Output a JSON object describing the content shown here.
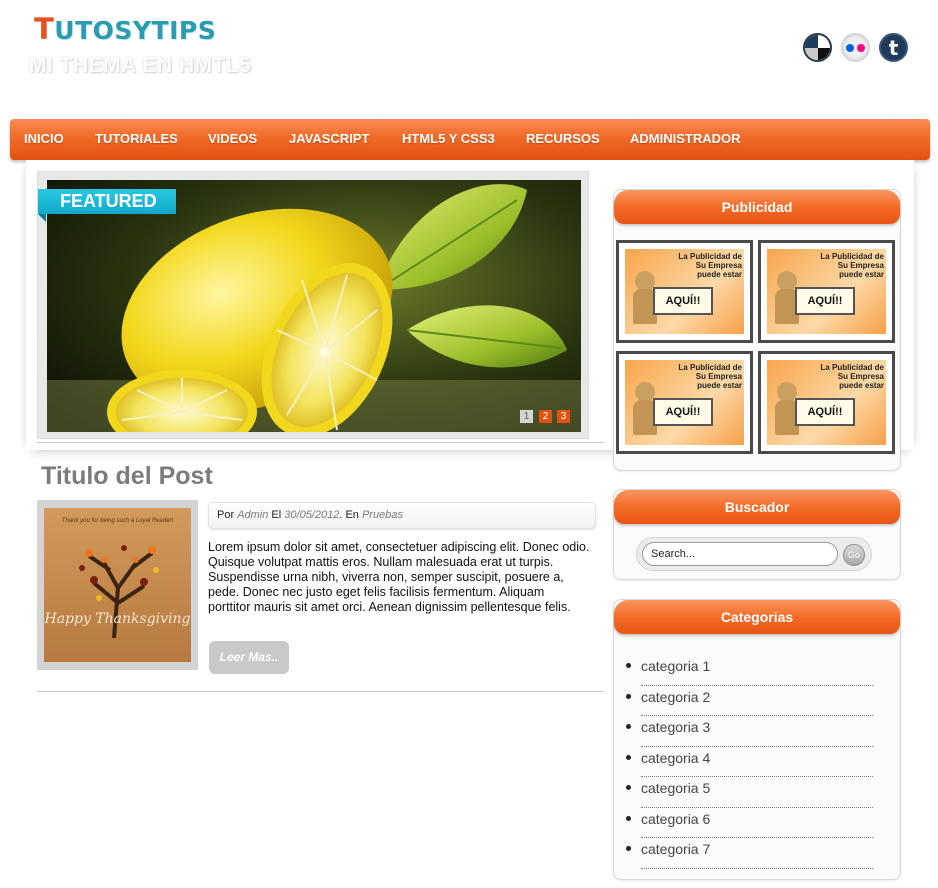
{
  "header": {
    "logo_first": "T",
    "logo_rest": "UTOSYTIPS",
    "tagline": "MI THEMA EN HMTL5"
  },
  "nav": {
    "items": [
      "INICIO",
      "TUTORIALES",
      "VIDEOS",
      "JAVASCRIPT",
      "HTML5 Y CSS3",
      "RECURSOS",
      "ADMINISTRADOR"
    ]
  },
  "slider": {
    "badge": "FEATURED",
    "pages": [
      "1",
      "2",
      "3"
    ]
  },
  "post": {
    "title": "Titulo del Post",
    "meta_by": "Por ",
    "author": "Admin",
    "meta_on": " El ",
    "date": "30/05/2012",
    "meta_in": ". En ",
    "category": "Pruebas",
    "excerpt": "Lorem ipsum dolor sit amet, consectetuer adipiscing elit. Donec odio. Quisque volutpat mattis eros. Nullam malesuada erat ut turpis. Suspendisse urna nibh, viverra non, semper suscipit, posuere a, pede. Donec nec justo eget felis facilisis fermentum. Aliquam porttitor mauris sit amet orci. Aenean dignissim pellentesque felis.",
    "read_more": "Leer Mas..",
    "thumb_caption_top": "Thank you for being such a Loyal Reader!",
    "thumb_caption": "Happy Thanksgiving"
  },
  "sidebar": {
    "ads_title": "Publicidad",
    "ad_text": "La Publicidad de Su Empresa puede estar",
    "ad_board": "AQUÍ!!",
    "search_title": "Buscador",
    "search_placeholder": "Search...",
    "search_button": "Go",
    "categories_title": "Categorias",
    "categories": [
      "categoria 1",
      "categoria 2",
      "categoria 3",
      "categoria 4",
      "categoria 5",
      "categoria 6",
      "categoria 7"
    ]
  },
  "colors": {
    "accent_orange": "#f06a26",
    "accent_cyan": "#10a9c8",
    "pager_active": "#e2520e"
  }
}
